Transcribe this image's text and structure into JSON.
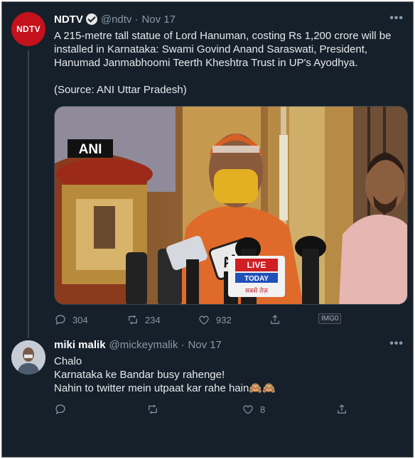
{
  "tweet1": {
    "author_name": "NDTV",
    "handle": "@ndtv",
    "separator": "·",
    "date": "Nov 17",
    "avatar_text": "NDTV",
    "more": "•••",
    "text": "A 215-metre tall statue of Lord Hanuman, costing Rs 1,200 crore will be installed in Karnataka: Swami Govind Anand Saraswati, President, Hanumad Janmabhoomi Teerth Kheshtra Trust in UP's Ayodhya.",
    "source": "(Source: ANI Uttar Pradesh)",
    "media": {
      "watermark": "ANI",
      "mic_label_ani": "ANI",
      "mic_label_live": "LIVE",
      "mic_label_today": "TODAY",
      "mic_label_hindi": "सबसे तेज़"
    },
    "actions": {
      "reply_count": "304",
      "retweet_count": "234",
      "like_count": "932",
      "img_button": "IMG0"
    }
  },
  "tweet2": {
    "author_name": "miki malik",
    "handle": "@mickeymalik",
    "separator": "·",
    "date": "Nov 17",
    "more": "•••",
    "lines": [
      "Chalo",
      "Karnataka ke Bandar busy rahenge!",
      "Nahin to twitter mein utpaat kar rahe hain🙈🙈"
    ],
    "actions": {
      "like_count": "8"
    }
  },
  "colors": {
    "background": "#15202b",
    "secondary_text": "#8899a6",
    "ndtv_red": "#c4111b"
  },
  "icons": [
    "reply-icon",
    "retweet-icon",
    "like-icon",
    "share-icon",
    "verified-icon",
    "more-icon"
  ]
}
